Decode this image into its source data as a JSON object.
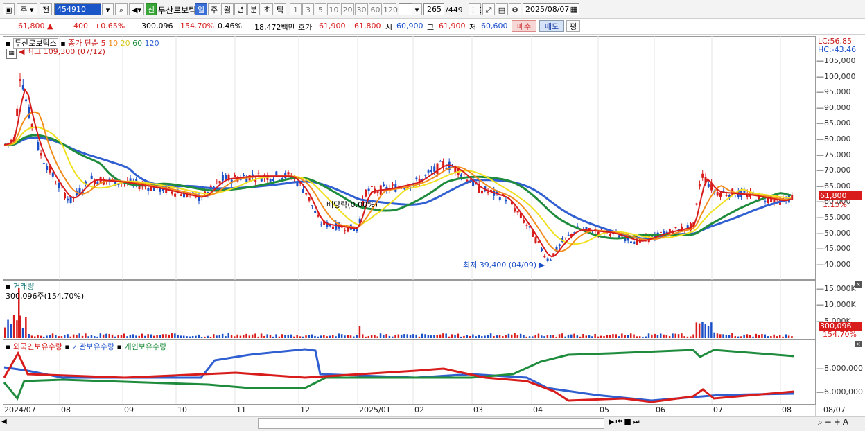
{
  "toolbar": {
    "market": "주",
    "type": "전",
    "code": "454910",
    "new_badge": "신",
    "stock_name": "두산로보틱",
    "periods": [
      "일",
      "주",
      "월",
      "년",
      "분",
      "초",
      "틱"
    ],
    "numbers": [
      "1",
      "3",
      "5",
      "10",
      "20",
      "30",
      "60",
      "120"
    ],
    "count_current": "265",
    "count_total": "/449",
    "date": "2025/08/07"
  },
  "quote": {
    "price": "61,800",
    "change": "400",
    "change_pct": "+0.65%",
    "volume": "300,096",
    "volume_ratio": "154.70%",
    "turnover": "0.46%",
    "amount": "18,472백만",
    "bid_label": "호가",
    "bid": "61,900",
    "ask": "61,800",
    "open_label": "시",
    "open": "60,900",
    "high_label": "고",
    "high": "61,900",
    "low_label": "저",
    "low": "60,600",
    "buy": "매수",
    "sell": "매도",
    "eval": "평"
  },
  "price_chart": {
    "legend_name": "두산로보틱스",
    "legend_ma": "종가 단순",
    "ma": [
      {
        "label": "5",
        "color": "#d81c1c"
      },
      {
        "label": "10",
        "color": "#f28c1c"
      },
      {
        "label": "20",
        "color": "#f0e020"
      },
      {
        "label": "60",
        "color": "#1e8c3c"
      },
      {
        "label": "120",
        "color": "#2f5fd0"
      }
    ],
    "lc": "LC:56.85",
    "hc": "HC:-43.46",
    "high_note": "최고 109,300 (07/12)",
    "low_note": "최저 39,400 (04/09)",
    "dividend_note": "배당락(0.00%)",
    "current_tag": "61,800",
    "current_pct": "1.15%",
    "yticks": [
      "105,000",
      "100,000",
      "95,000",
      "90,000",
      "85,000",
      "80,000",
      "75,000",
      "70,000",
      "65,000",
      "60,000",
      "55,000",
      "50,000",
      "45,000",
      "40,000"
    ]
  },
  "volume_chart": {
    "title": "거래량",
    "value": "300,096주(154.70%)",
    "yticks": [
      "15,000K",
      "10,000K",
      "5,000K"
    ],
    "current_tag": "300,096",
    "current_pct": "154.70%"
  },
  "holding_chart": {
    "legends": [
      "외국인보유수량",
      "기관보유수량",
      "개인보유수량"
    ],
    "yticks": [
      "8,000,000",
      "6,000,000"
    ]
  },
  "xaxis": [
    "2024/07",
    "08",
    "09",
    "10",
    "11",
    "12",
    "2025/01",
    "02",
    "03",
    "04",
    "05",
    "06",
    "07",
    "08",
    "08/07"
  ]
}
